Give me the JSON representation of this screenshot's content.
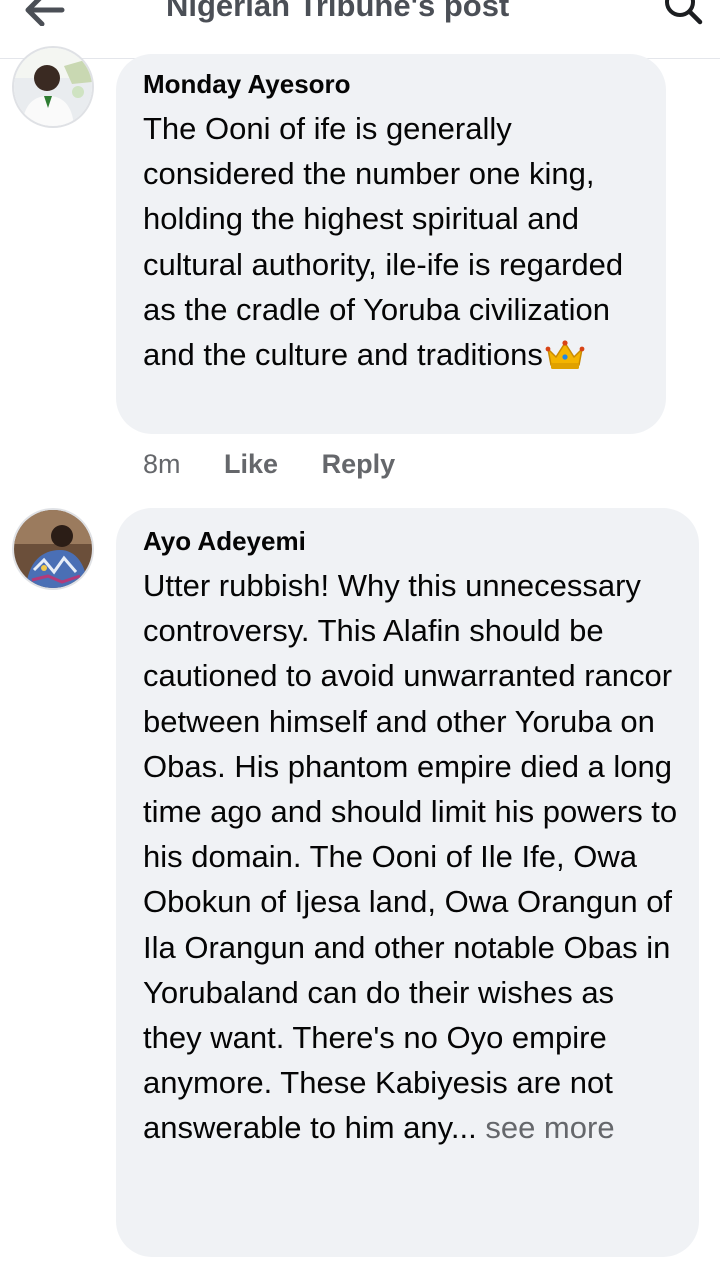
{
  "header": {
    "title": "Nigerian Tribune's post",
    "back_icon": "arrow-left-icon",
    "search_icon": "search-icon"
  },
  "comments": [
    {
      "author": "Monday Ayesoro",
      "text": "The Ooni of ife is generally considered the number one king, holding the highest spiritual and cultural authority,  ile-ife is regarded as the cradle of Yoruba civilization  and the culture and traditions",
      "emoji": "crown-icon",
      "time": "8m",
      "like_label": "Like",
      "reply_label": "Reply"
    },
    {
      "author": "Ayo Adeyemi",
      "text": "Utter rubbish! Why this unnecessary controversy. This Alafin should be cautioned to avoid unwarranted rancor between himself and other Yoruba on Obas. His phantom empire died a long time ago and should limit his powers to his domain. The Ooni of Ile Ife, Owa Obokun of Ijesa land, Owa Orangun of Ila Orangun and other notable Obas in Yorubaland can do their wishes as they want. There's no Oyo empire anymore. These Kabiyesis are not answerable to him any...",
      "see_more_label": " see more"
    }
  ],
  "colors": {
    "bubble": "#f0f2f5",
    "secondary_text": "#65676b",
    "primary_text": "#050505"
  }
}
